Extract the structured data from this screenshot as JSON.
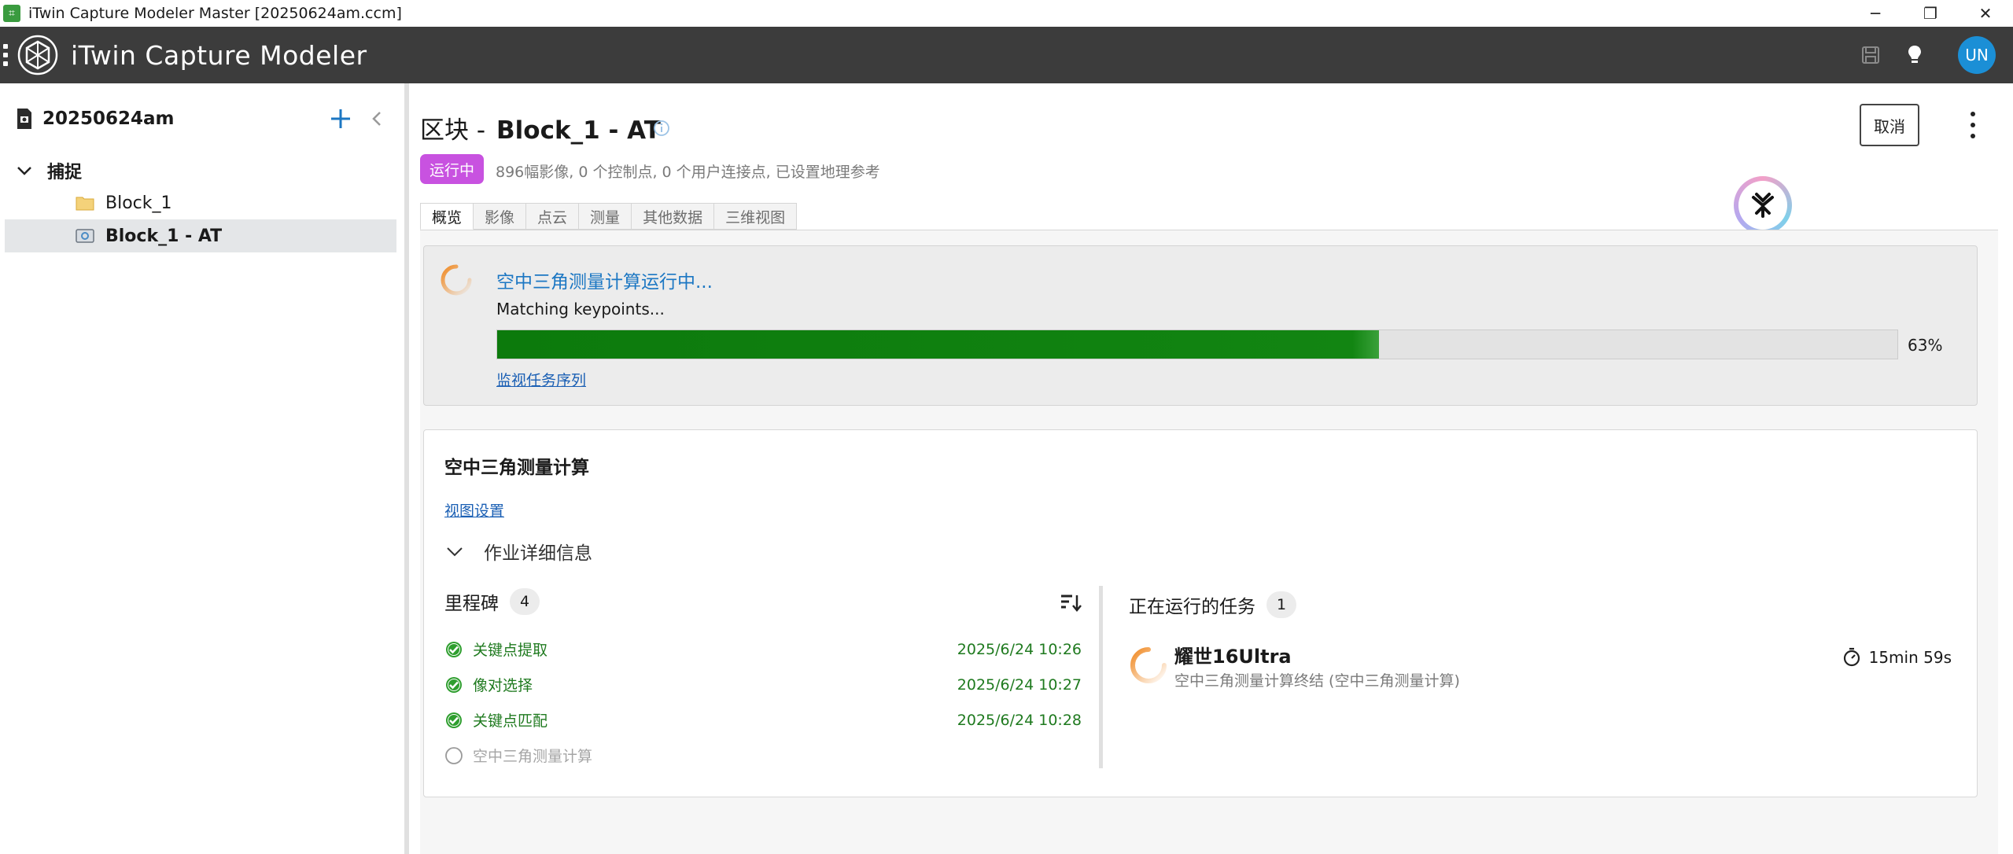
{
  "window": {
    "title": "iTwin Capture Modeler Master [20250624am.ccm]",
    "controls": {
      "minimize": "─",
      "restore": "❐",
      "close": "✕"
    }
  },
  "app": {
    "title": "iTwin Capture Modeler",
    "user_initials": "UN",
    "icons": [
      "menu-dots-icon",
      "app-logo-icon",
      "save-icon",
      "lightbulb-icon"
    ]
  },
  "sidebar": {
    "project_name": "20250624am",
    "tree": {
      "group_label": "捕捉",
      "items": [
        {
          "label": "Block_1",
          "icon": "folder-icon",
          "selected": false
        },
        {
          "label": "Block_1 - AT",
          "icon": "photo-block-icon",
          "selected": true
        }
      ]
    }
  },
  "main": {
    "title_prefix": "区块 -",
    "title_name": "Block_1 - AT",
    "status": "运行中",
    "summary": "896幅影像, 0 个控制点, 0 个用户连接点, 已设置地理参考",
    "cancel_label": "取消",
    "tabs": [
      {
        "label": "概览",
        "active": true
      },
      {
        "label": "影像",
        "active": false
      },
      {
        "label": "点云",
        "active": false
      },
      {
        "label": "测量",
        "active": false
      },
      {
        "label": "其他数据",
        "active": false
      },
      {
        "label": "三维视图",
        "active": false
      }
    ]
  },
  "progress": {
    "title": "空中三角测量计算运行中...",
    "subtitle": "Matching keypoints...",
    "percent": 63,
    "percent_label": "63%",
    "link": "监视任务序列"
  },
  "details": {
    "title": "空中三角测量计算",
    "view_settings_link": "视图设置",
    "job_details_label": "作业详细信息",
    "milestones": {
      "label": "里程碑",
      "count": "4",
      "items": [
        {
          "label": "关键点提取",
          "time": "2025/6/24 10:26",
          "done": true
        },
        {
          "label": "像对选择",
          "time": "2025/6/24 10:27",
          "done": true
        },
        {
          "label": "关键点匹配",
          "time": "2025/6/24 10:28",
          "done": true
        },
        {
          "label": "空中三角测量计算",
          "time": "",
          "done": false
        }
      ]
    },
    "running": {
      "label": "正在运行的任务",
      "count": "1",
      "task": {
        "name": "耀世16Ultra",
        "description": "空中三角测量计算终结 (空中三角测量计算)",
        "duration": "15min 59s"
      }
    }
  },
  "colors": {
    "accent_blue": "#1c77c3",
    "status_badge": "#c852e0",
    "progress_green": "#128512",
    "milestone_green": "#1f7a1f",
    "spinner_orange": "#f08a24"
  }
}
